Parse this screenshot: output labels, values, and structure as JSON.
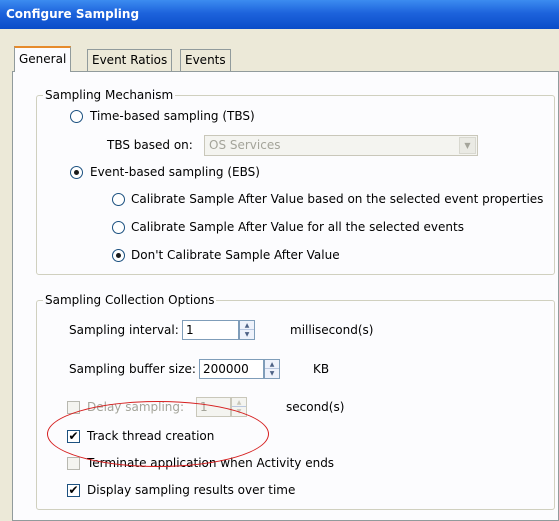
{
  "window": {
    "title": "Configure Sampling"
  },
  "tabs": [
    {
      "label": "General",
      "active": true
    },
    {
      "label": "Event Ratios",
      "active": false
    },
    {
      "label": "Events",
      "active": false
    }
  ],
  "sampling_mechanism": {
    "legend": "Sampling Mechanism",
    "tbs_radio": {
      "label": "Time-based sampling (TBS)",
      "selected": false
    },
    "tbs_based_on": {
      "label": "TBS based on:",
      "value": "OS Services",
      "enabled": false
    },
    "ebs_radio": {
      "label": "Event-based sampling (EBS)",
      "selected": true
    },
    "calibration_options": [
      {
        "label": "Calibrate Sample After Value based on the selected event properties",
        "selected": false
      },
      {
        "label": "Calibrate Sample After Value for all the selected events",
        "selected": false
      },
      {
        "label": "Don't Calibrate Sample After Value",
        "selected": true
      }
    ]
  },
  "collection_options": {
    "legend": "Sampling Collection Options",
    "interval": {
      "label": "Sampling interval:",
      "value": "1",
      "unit": "millisecond(s)"
    },
    "buffer": {
      "label": "Sampling buffer size:",
      "value": "200000",
      "unit": "KB"
    },
    "delay": {
      "label": "Delay sampling:",
      "value": "1",
      "unit": "second(s)",
      "checked": false,
      "enabled": false
    },
    "track_threads": {
      "label": "Track thread creation",
      "checked": true
    },
    "terminate_app": {
      "label": "Terminate application when Activity ends",
      "checked": false,
      "enabled": false
    },
    "display_over_time": {
      "label": "Display sampling results over time",
      "checked": true
    }
  },
  "colors": {
    "title_bar": "#1d63dc",
    "dialog_bg": "#ece9d8",
    "highlight_circle": "#d62020"
  },
  "icons": {
    "checkmark": "✔",
    "spin_up": "▲",
    "spin_down": "▼",
    "dropdown": "▼"
  }
}
